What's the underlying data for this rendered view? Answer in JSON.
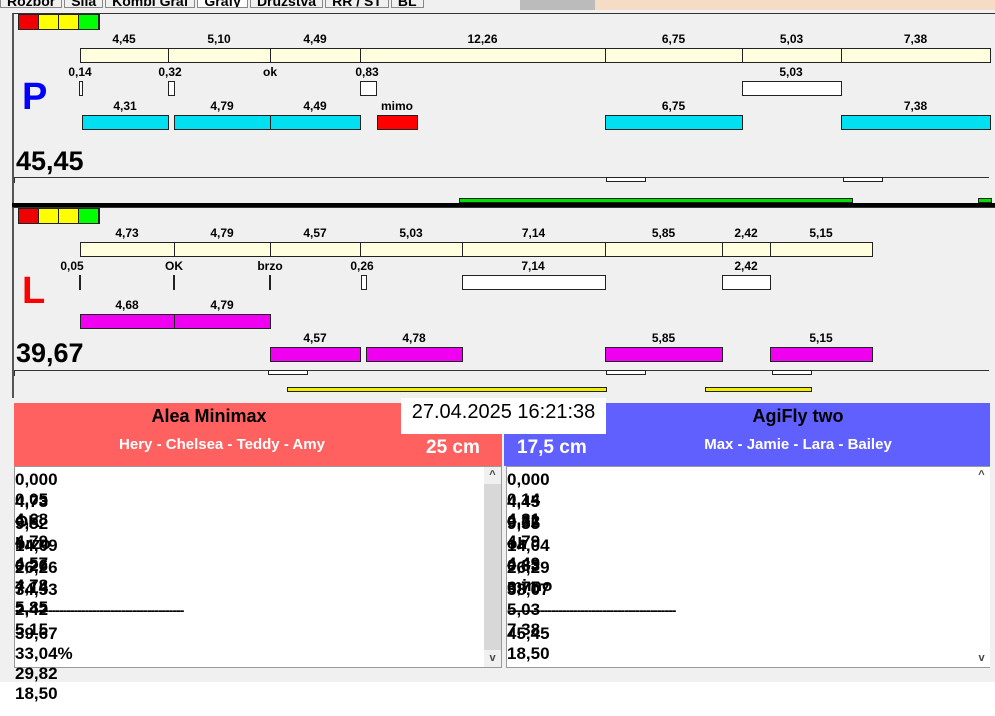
{
  "tabs": [
    "Rozbor",
    "Sila",
    "Kombi Graf",
    "Grafy",
    "Družstva",
    "RR / ST",
    "BL"
  ],
  "lanes": {
    "P": {
      "letter": "P",
      "letter_color": "#0000ff",
      "score": "45,45",
      "row1": [
        "4,45",
        "5,10",
        "4,49",
        "12,26",
        "6,75",
        "5,03",
        "7,38"
      ],
      "row2": [
        "0,14",
        "0,32",
        "ok",
        "0,83",
        "5,03"
      ],
      "row3": [
        "4,31",
        "4,79",
        "4,49",
        "mimo",
        "6,75",
        "7,38"
      ]
    },
    "L": {
      "letter": "L",
      "letter_color": "#ff0000",
      "score": "39,67",
      "row1": [
        "4,73",
        "4,79",
        "4,57",
        "5,03",
        "7,14",
        "5,85",
        "2,42",
        "5,15"
      ],
      "row2": [
        "0,05",
        "OK",
        "brzo",
        "0,26",
        "7,14",
        "2,42"
      ],
      "row3": [
        "4,68",
        "4,79"
      ],
      "row4": [
        "4,57",
        "4,78",
        "5,85",
        "5,15"
      ]
    }
  },
  "colors": {
    "cyan": "#00e0f0",
    "magenta": "#f000f0",
    "miss": "#ff0000",
    "green": "#00e000",
    "yellow": "#f0f000",
    "cream": "#ffffe0",
    "left_header": "#ff6060",
    "right_header": "#6060ff"
  },
  "datetime": "27.04.2025 16:21:38",
  "left": {
    "team": "Alea Minimax",
    "handlers": "Hery - Chelsea - Teddy - Amy",
    "height": "25 cm",
    "rows": [
      [
        "0,000",
        "0,05",
        "4,68"
      ],
      [
        "4,73",
        "OK",
        "4,79"
      ],
      [
        "9,52",
        "brzo",
        "4,57"
      ],
      [
        "14,09",
        "0,26",
        "4,78"
      ],
      [
        "26,26",
        "7,14",
        "5,85"
      ],
      [
        "34,53",
        "2,42",
        "5,15"
      ]
    ],
    "separator": "----------------------------------------------",
    "summary": [
      "39,67",
      "33,04%",
      "29,82",
      "18,50"
    ]
  },
  "right": {
    "team": "AgiFly two",
    "handlers": "Max - Jamie - Lara - Bailey",
    "height": "17,5 cm",
    "rows": [
      [
        "0,000",
        "0,14",
        "4,31"
      ],
      [
        "4,45",
        "0,32",
        "4,79"
      ],
      [
        "9,55",
        "ok",
        "4,49"
      ],
      [
        "14,04",
        "0,83",
        "mimo"
      ],
      [
        "26,29",
        "",
        "6,75"
      ],
      [
        "38,07",
        "5,03",
        "7,38"
      ]
    ],
    "separator": "----------------------------------------------",
    "summary": [
      "45,45",
      "",
      "",
      "18,50"
    ]
  }
}
